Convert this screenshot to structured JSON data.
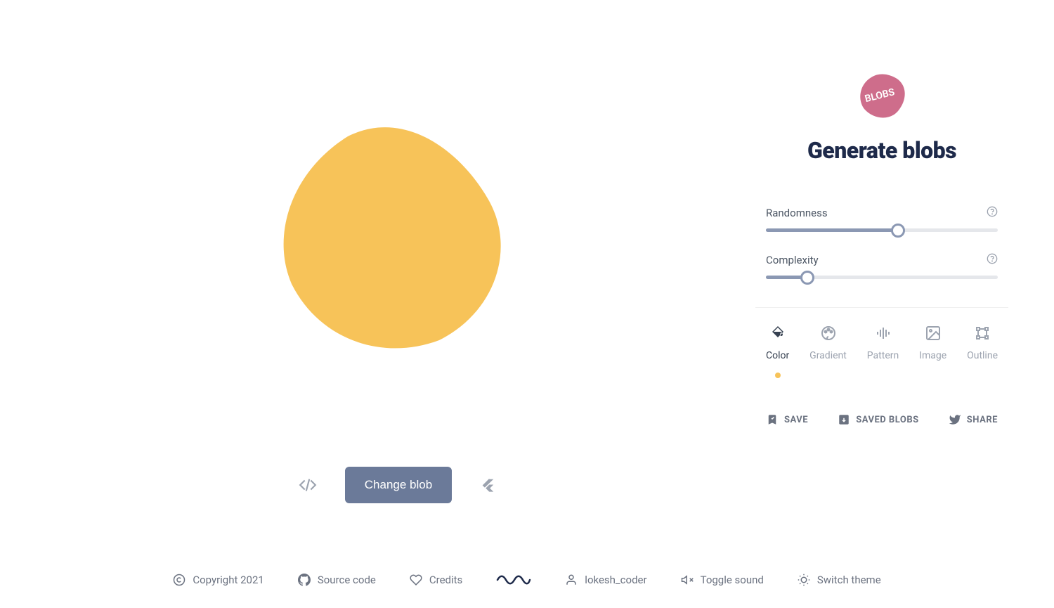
{
  "heading": "Generate blobs",
  "logo_text": "BLOBS",
  "blob_color": "#f7c359",
  "sliders": {
    "randomness": {
      "label": "Randomness",
      "value": 57
    },
    "complexity": {
      "label": "Complexity",
      "value": 18
    }
  },
  "tabs": [
    {
      "label": "Color",
      "active": true
    },
    {
      "label": "Gradient",
      "active": false
    },
    {
      "label": "Pattern",
      "active": false
    },
    {
      "label": "Image",
      "active": false
    },
    {
      "label": "Outline",
      "active": false
    }
  ],
  "actions": {
    "change_blob": "Change blob",
    "save": "SAVE",
    "saved_blobs": "SAVED BLOBS",
    "share": "SHARE"
  },
  "footer": {
    "copyright": "Copyright 2021",
    "source_code": "Source code",
    "credits": "Credits",
    "username": "lokesh_coder",
    "toggle_sound": "Toggle sound",
    "switch_theme": "Switch theme"
  }
}
